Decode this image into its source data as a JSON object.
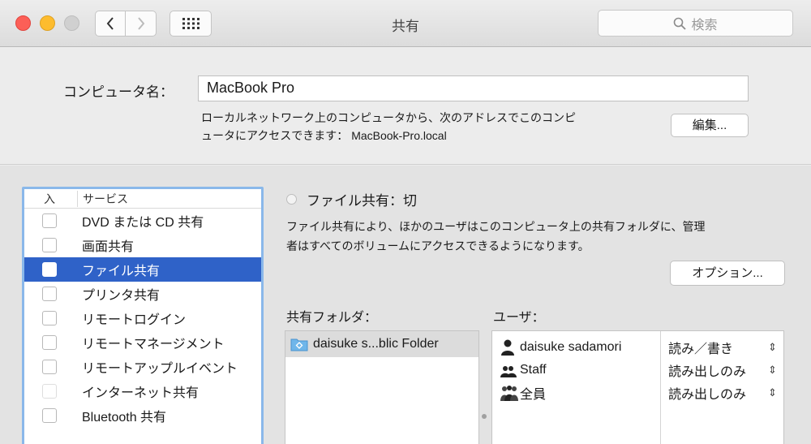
{
  "window": {
    "title": "共有",
    "search_placeholder": "検索"
  },
  "computer": {
    "label": "コンピュータ名：",
    "name": "MacBook Pro",
    "address_line1": "ローカルネットワーク上のコンピュータから、次のアドレスでこのコンピ",
    "address_line2": "ュータにアクセスできます： MacBook-Pro.local",
    "edit_label": "編集..."
  },
  "services": {
    "header_on": "入",
    "header_service": "サービス",
    "items": [
      {
        "label": "DVD または CD 共有",
        "checked": false,
        "selected": false
      },
      {
        "label": "画面共有",
        "checked": false,
        "selected": false
      },
      {
        "label": "ファイル共有",
        "checked": false,
        "selected": true
      },
      {
        "label": "プリンタ共有",
        "checked": false,
        "selected": false
      },
      {
        "label": "リモートログイン",
        "checked": false,
        "selected": false
      },
      {
        "label": "リモートマネージメント",
        "checked": false,
        "selected": false
      },
      {
        "label": "リモートアップルイベント",
        "checked": false,
        "selected": false
      },
      {
        "label": "インターネット共有",
        "checked": false,
        "selected": false
      },
      {
        "label": "Bluetooth 共有",
        "checked": false,
        "selected": false
      }
    ]
  },
  "file_sharing": {
    "status": "ファイル共有：切",
    "desc_line1": "ファイル共有により、ほかのユーザはこのコンピュータ上の共有フォルダに、管理",
    "desc_line2": "者はすべてのボリュームにアクセスできるようになります。",
    "options_label": "オプション..."
  },
  "shared_folders": {
    "label": "共有フォルダ：",
    "items": [
      "daisuke s...blic Folder"
    ]
  },
  "users": {
    "label": "ユーザ：",
    "items": [
      {
        "name": "daisuke sadamori",
        "permission": "読み／書き",
        "icon": "user-icon"
      },
      {
        "name": "Staff",
        "permission": "読み出しのみ",
        "icon": "group-icon"
      },
      {
        "name": "全員",
        "permission": "読み出しのみ",
        "icon": "everyone-icon"
      }
    ]
  },
  "colors": {
    "selection": "#2f62c8",
    "focus_ring": "#8ab8ea"
  }
}
